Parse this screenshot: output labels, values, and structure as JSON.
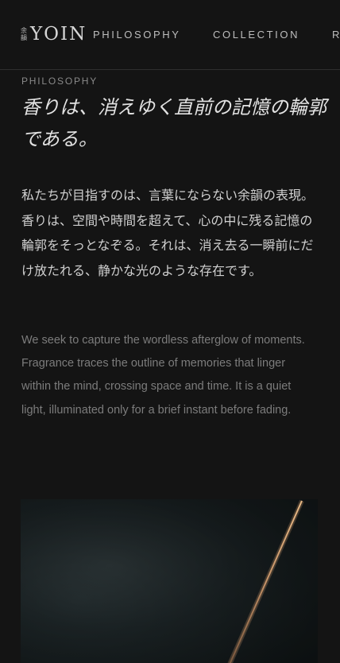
{
  "header": {
    "logo_kanji_top": "余",
    "logo_kanji_bottom": "韻",
    "logo_word": "YOIN",
    "nav": [
      "PHILOSOPHY",
      "COLLECTION",
      "R"
    ]
  },
  "main": {
    "section_label": "PHILOSOPHY",
    "headline": "香りは、消えゆく直前の記憶の輪郭である。",
    "body_jp": "私たちが目指すのは、言葉にならない余韻の表現。香りは、空間や時間を超えて、心の中に残る記憶の輪郭をそっとなぞる。それは、消え去る一瞬前にだけ放たれる、静かな光のような存在です。",
    "body_en": "We seek to capture the wordless afterglow of moments. Fragrance traces the outline of memories that linger within the mind, crossing space and time. It is a quiet light, illuminated only for a brief instant before fading."
  },
  "colors": {
    "background": "#141414",
    "text_primary": "#e2e2e2",
    "text_secondary": "#7c7c7c",
    "light_streak": "#d9a070"
  }
}
